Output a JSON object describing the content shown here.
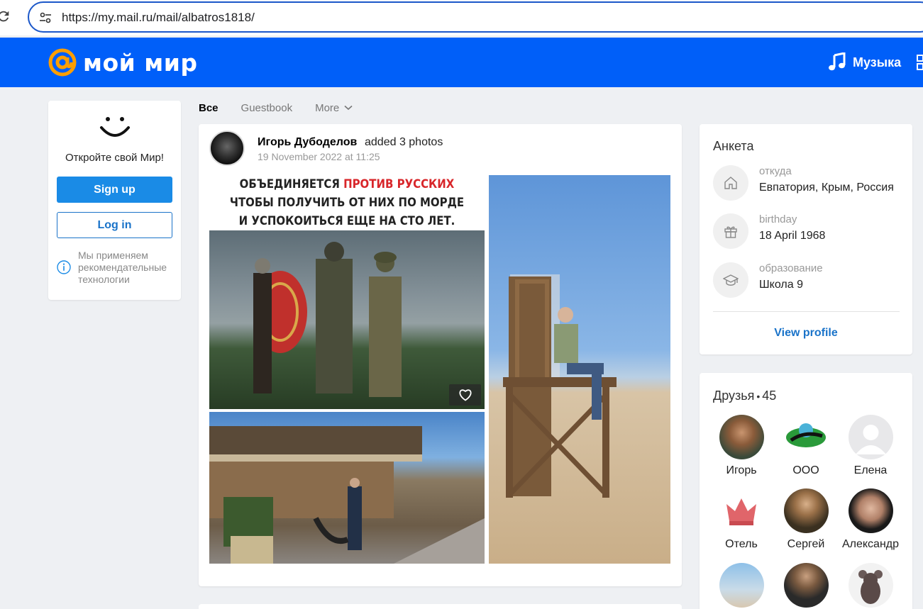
{
  "browser": {
    "url": "https://my.mail.ru/mail/albatros1818/"
  },
  "header": {
    "logo_text": "мой мир",
    "music_label": "Музыка"
  },
  "left_card": {
    "prompt": "Откройте свой Мир!",
    "signup_label": "Sign up",
    "login_label": "Log in",
    "rec_text": "Мы применяем рекомендательные технологии"
  },
  "tabs": [
    {
      "label": "Все",
      "active": true
    },
    {
      "label": "Guestbook",
      "active": false
    },
    {
      "label": "More",
      "active": false
    }
  ],
  "post": {
    "author": "Игорь Дубоделов",
    "action": "added 3 photos",
    "date": "19 November 2022 at 11:25",
    "poster": {
      "line1_a": "ОБЪЕДИНЯЕТСЯ ",
      "line1_b": "ПРОТИВ РУССКИХ",
      "line2": "ЧТОБЫ ПОЛУЧИТЬ ОТ НИХ ПО МОРДЕ",
      "line3": "И УСПОКОИТЬСЯ ЕЩЕ НА СТО ЛЕТ."
    }
  },
  "profile": {
    "title": "Анкета",
    "rows": [
      {
        "label": "откуда",
        "value": "Евпатория, Крым, Россия",
        "icon": "home-icon"
      },
      {
        "label": "birthday",
        "value": "18 April 1968",
        "icon": "gift-icon"
      },
      {
        "label": "образование",
        "value": "Школа 9",
        "icon": "graduation-cap-icon"
      }
    ],
    "view_profile": "View profile"
  },
  "friends": {
    "title": "Друзья",
    "count": "45",
    "items": [
      {
        "name": "Игорь"
      },
      {
        "name": "ООО"
      },
      {
        "name": "Елена"
      },
      {
        "name": "Отель"
      },
      {
        "name": "Сергей"
      },
      {
        "name": "Александр"
      },
      {
        "name": ""
      },
      {
        "name": ""
      },
      {
        "name": ""
      }
    ]
  },
  "colors": {
    "header_bg": "#005ff9",
    "logo_at": "#ff9e00",
    "primary_button": "#1a8be6",
    "link": "#1a73c9"
  }
}
